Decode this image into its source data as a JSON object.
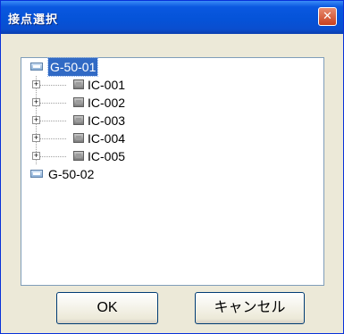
{
  "window": {
    "title": "接点選択",
    "close_glyph": "✕"
  },
  "tree": {
    "nodes": [
      {
        "label": "G-50-01",
        "selected": true,
        "icon": "group-icon",
        "children": [
          {
            "label": "IC-001",
            "icon": "ic-icon"
          },
          {
            "label": "IC-002",
            "icon": "ic-icon"
          },
          {
            "label": "IC-003",
            "icon": "ic-icon"
          },
          {
            "label": "IC-004",
            "icon": "ic-icon"
          },
          {
            "label": "IC-005",
            "icon": "ic-icon"
          }
        ]
      },
      {
        "label": "G-50-02",
        "selected": false,
        "icon": "group-icon"
      }
    ],
    "expander_glyph": "+"
  },
  "buttons": {
    "ok_label": "OK",
    "cancel_label": "キャンセル"
  }
}
